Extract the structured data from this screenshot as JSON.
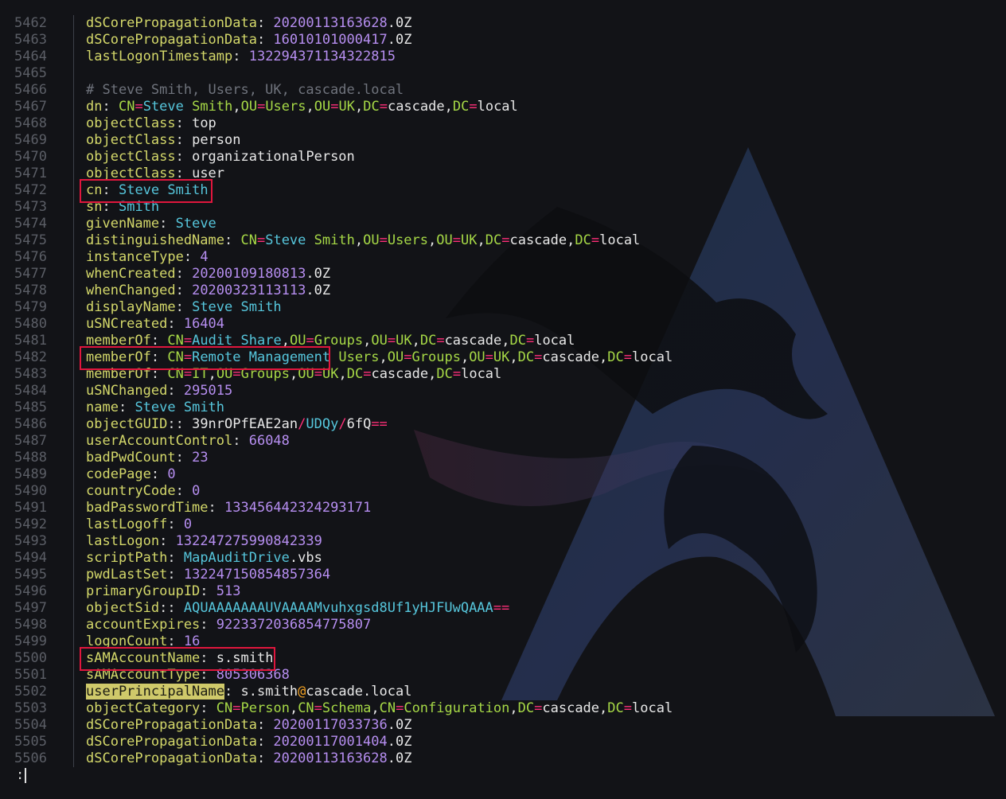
{
  "viewer": {
    "lines": [
      {
        "num": "5462",
        "segs": [
          [
            "k",
            "dSCorePropagationData"
          ],
          [
            "p",
            ": "
          ],
          [
            "n",
            "20200113163628"
          ],
          [
            "v",
            ".0Z"
          ]
        ]
      },
      {
        "num": "5463",
        "segs": [
          [
            "k",
            "dSCorePropagationData"
          ],
          [
            "p",
            ": "
          ],
          [
            "n",
            "16010101000417"
          ],
          [
            "v",
            ".0Z"
          ]
        ]
      },
      {
        "num": "5464",
        "segs": [
          [
            "k",
            "lastLogonTimestamp"
          ],
          [
            "p",
            ": "
          ],
          [
            "n",
            "132294371134322815"
          ]
        ]
      },
      {
        "num": "5465",
        "segs": []
      },
      {
        "num": "5466",
        "segs": [
          [
            "c",
            "# Steve Smith, Users, UK, cascade.local"
          ]
        ]
      },
      {
        "num": "5467",
        "segs": [
          [
            "k",
            "dn"
          ],
          [
            "p",
            ": "
          ],
          [
            "g",
            "CN"
          ],
          [
            "r",
            "="
          ],
          [
            "s",
            "Steve"
          ],
          [
            "v",
            " "
          ],
          [
            "g",
            "Smith"
          ],
          [
            "v",
            ","
          ],
          [
            "g",
            "OU"
          ],
          [
            "r",
            "="
          ],
          [
            "g",
            "Users"
          ],
          [
            "v",
            ","
          ],
          [
            "g",
            "OU"
          ],
          [
            "r",
            "="
          ],
          [
            "g",
            "UK"
          ],
          [
            "v",
            ","
          ],
          [
            "g",
            "DC"
          ],
          [
            "r",
            "="
          ],
          [
            "v",
            "cascade"
          ],
          [
            "v",
            ","
          ],
          [
            "g",
            "DC"
          ],
          [
            "r",
            "="
          ],
          [
            "v",
            "local"
          ]
        ]
      },
      {
        "num": "5468",
        "segs": [
          [
            "k",
            "objectClass"
          ],
          [
            "p",
            ": "
          ],
          [
            "v",
            "top"
          ]
        ]
      },
      {
        "num": "5469",
        "segs": [
          [
            "k",
            "objectClass"
          ],
          [
            "p",
            ": "
          ],
          [
            "v",
            "person"
          ]
        ]
      },
      {
        "num": "5470",
        "segs": [
          [
            "k",
            "objectClass"
          ],
          [
            "p",
            ": "
          ],
          [
            "v",
            "organizationalPerson"
          ]
        ]
      },
      {
        "num": "5471",
        "segs": [
          [
            "k",
            "objectClass"
          ],
          [
            "p",
            ": "
          ],
          [
            "v",
            "user"
          ]
        ]
      },
      {
        "num": "5472",
        "segs": [
          [
            "k",
            "cn"
          ],
          [
            "p",
            ": "
          ],
          [
            "s",
            "Steve Smith"
          ]
        ]
      },
      {
        "num": "5473",
        "segs": [
          [
            "k",
            "sn"
          ],
          [
            "p",
            ": "
          ],
          [
            "s",
            "Smith"
          ]
        ]
      },
      {
        "num": "5474",
        "segs": [
          [
            "k",
            "givenName"
          ],
          [
            "p",
            ": "
          ],
          [
            "s",
            "Steve"
          ]
        ]
      },
      {
        "num": "5475",
        "segs": [
          [
            "k",
            "distinguishedName"
          ],
          [
            "p",
            ": "
          ],
          [
            "g",
            "CN"
          ],
          [
            "r",
            "="
          ],
          [
            "s",
            "Steve"
          ],
          [
            "v",
            " "
          ],
          [
            "g",
            "Smith"
          ],
          [
            "v",
            ","
          ],
          [
            "g",
            "OU"
          ],
          [
            "r",
            "="
          ],
          [
            "g",
            "Users"
          ],
          [
            "v",
            ","
          ],
          [
            "g",
            "OU"
          ],
          [
            "r",
            "="
          ],
          [
            "g",
            "UK"
          ],
          [
            "v",
            ","
          ],
          [
            "g",
            "DC"
          ],
          [
            "r",
            "="
          ],
          [
            "v",
            "cascade"
          ],
          [
            "v",
            ","
          ],
          [
            "g",
            "DC"
          ],
          [
            "r",
            "="
          ],
          [
            "v",
            "local"
          ]
        ]
      },
      {
        "num": "5476",
        "segs": [
          [
            "k",
            "instanceType"
          ],
          [
            "p",
            ": "
          ],
          [
            "n",
            "4"
          ]
        ]
      },
      {
        "num": "5477",
        "segs": [
          [
            "k",
            "whenCreated"
          ],
          [
            "p",
            ": "
          ],
          [
            "n",
            "20200109180813"
          ],
          [
            "v",
            ".0Z"
          ]
        ]
      },
      {
        "num": "5478",
        "segs": [
          [
            "k",
            "whenChanged"
          ],
          [
            "p",
            ": "
          ],
          [
            "n",
            "20200323113113"
          ],
          [
            "v",
            ".0Z"
          ]
        ]
      },
      {
        "num": "5479",
        "segs": [
          [
            "k",
            "displayName"
          ],
          [
            "p",
            ": "
          ],
          [
            "s",
            "Steve Smith"
          ]
        ]
      },
      {
        "num": "5480",
        "segs": [
          [
            "k",
            "uSNCreated"
          ],
          [
            "p",
            ": "
          ],
          [
            "n",
            "16404"
          ]
        ]
      },
      {
        "num": "5481",
        "segs": [
          [
            "k",
            "memberOf"
          ],
          [
            "p",
            ": "
          ],
          [
            "g",
            "CN"
          ],
          [
            "r",
            "="
          ],
          [
            "s",
            "Audit Share"
          ],
          [
            "v",
            ","
          ],
          [
            "g",
            "OU"
          ],
          [
            "r",
            "="
          ],
          [
            "g",
            "Groups"
          ],
          [
            "v",
            ","
          ],
          [
            "g",
            "OU"
          ],
          [
            "r",
            "="
          ],
          [
            "g",
            "UK"
          ],
          [
            "v",
            ","
          ],
          [
            "g",
            "DC"
          ],
          [
            "r",
            "="
          ],
          [
            "v",
            "cascade"
          ],
          [
            "v",
            ","
          ],
          [
            "g",
            "DC"
          ],
          [
            "r",
            "="
          ],
          [
            "v",
            "local"
          ]
        ]
      },
      {
        "num": "5482",
        "segs": [
          [
            "k",
            "memberOf"
          ],
          [
            "p",
            ": "
          ],
          [
            "g",
            "CN"
          ],
          [
            "r",
            "="
          ],
          [
            "s",
            "Remote Management "
          ],
          [
            "g",
            "Users"
          ],
          [
            "v",
            ","
          ],
          [
            "g",
            "OU"
          ],
          [
            "r",
            "="
          ],
          [
            "g",
            "Groups"
          ],
          [
            "v",
            ","
          ],
          [
            "g",
            "OU"
          ],
          [
            "r",
            "="
          ],
          [
            "g",
            "UK"
          ],
          [
            "v",
            ","
          ],
          [
            "g",
            "DC"
          ],
          [
            "r",
            "="
          ],
          [
            "v",
            "cascade"
          ],
          [
            "v",
            ","
          ],
          [
            "g",
            "DC"
          ],
          [
            "r",
            "="
          ],
          [
            "v",
            "local"
          ]
        ]
      },
      {
        "num": "5483",
        "segs": [
          [
            "k",
            "memberOf"
          ],
          [
            "p",
            ": "
          ],
          [
            "g",
            "CN"
          ],
          [
            "r",
            "="
          ],
          [
            "g",
            "IT"
          ],
          [
            "v",
            ","
          ],
          [
            "g",
            "OU"
          ],
          [
            "r",
            "="
          ],
          [
            "g",
            "Groups"
          ],
          [
            "v",
            ","
          ],
          [
            "g",
            "OU"
          ],
          [
            "r",
            "="
          ],
          [
            "g",
            "UK"
          ],
          [
            "v",
            ","
          ],
          [
            "g",
            "DC"
          ],
          [
            "r",
            "="
          ],
          [
            "v",
            "cascade"
          ],
          [
            "v",
            ","
          ],
          [
            "g",
            "DC"
          ],
          [
            "r",
            "="
          ],
          [
            "v",
            "local"
          ]
        ]
      },
      {
        "num": "5484",
        "segs": [
          [
            "k",
            "uSNChanged"
          ],
          [
            "p",
            ": "
          ],
          [
            "n",
            "295015"
          ]
        ]
      },
      {
        "num": "5485",
        "segs": [
          [
            "k",
            "name"
          ],
          [
            "p",
            ": "
          ],
          [
            "s",
            "Steve Smith"
          ]
        ]
      },
      {
        "num": "5486",
        "segs": [
          [
            "k",
            "objectGUID"
          ],
          [
            "p",
            ":: "
          ],
          [
            "v",
            "39nrOPfEAE2an"
          ],
          [
            "r",
            "/"
          ],
          [
            "s",
            "UDQy"
          ],
          [
            "r",
            "/"
          ],
          [
            "v",
            "6fQ"
          ],
          [
            "r",
            "=="
          ]
        ]
      },
      {
        "num": "5487",
        "segs": [
          [
            "k",
            "userAccountControl"
          ],
          [
            "p",
            ": "
          ],
          [
            "n",
            "66048"
          ]
        ]
      },
      {
        "num": "5488",
        "segs": [
          [
            "k",
            "badPwdCount"
          ],
          [
            "p",
            ": "
          ],
          [
            "n",
            "23"
          ]
        ]
      },
      {
        "num": "5489",
        "segs": [
          [
            "k",
            "codePage"
          ],
          [
            "p",
            ": "
          ],
          [
            "n",
            "0"
          ]
        ]
      },
      {
        "num": "5490",
        "segs": [
          [
            "k",
            "countryCode"
          ],
          [
            "p",
            ": "
          ],
          [
            "n",
            "0"
          ]
        ]
      },
      {
        "num": "5491",
        "segs": [
          [
            "k",
            "badPasswordTime"
          ],
          [
            "p",
            ": "
          ],
          [
            "n",
            "133456442324293171"
          ]
        ]
      },
      {
        "num": "5492",
        "segs": [
          [
            "k",
            "lastLogoff"
          ],
          [
            "p",
            ": "
          ],
          [
            "n",
            "0"
          ]
        ]
      },
      {
        "num": "5493",
        "segs": [
          [
            "k",
            "lastLogon"
          ],
          [
            "p",
            ": "
          ],
          [
            "n",
            "132247275990842339"
          ]
        ]
      },
      {
        "num": "5494",
        "segs": [
          [
            "k",
            "scriptPath"
          ],
          [
            "p",
            ": "
          ],
          [
            "s",
            "MapAuditDrive"
          ],
          [
            "v",
            ".vbs"
          ]
        ]
      },
      {
        "num": "5495",
        "segs": [
          [
            "k",
            "pwdLastSet"
          ],
          [
            "p",
            ": "
          ],
          [
            "n",
            "132247150854857364"
          ]
        ]
      },
      {
        "num": "5496",
        "segs": [
          [
            "k",
            "primaryGroupID"
          ],
          [
            "p",
            ": "
          ],
          [
            "n",
            "513"
          ]
        ]
      },
      {
        "num": "5497",
        "segs": [
          [
            "k",
            "objectSid"
          ],
          [
            "p",
            ":: "
          ],
          [
            "s",
            "AQUAAAAAAAUVAAAAMvuhxgsd8Uf1yHJFUwQAAA"
          ],
          [
            "r",
            "=="
          ]
        ]
      },
      {
        "num": "5498",
        "segs": [
          [
            "k",
            "accountExpires"
          ],
          [
            "p",
            ": "
          ],
          [
            "n",
            "9223372036854775807"
          ]
        ]
      },
      {
        "num": "5499",
        "segs": [
          [
            "k",
            "logonCount"
          ],
          [
            "p",
            ": "
          ],
          [
            "n",
            "16"
          ]
        ]
      },
      {
        "num": "5500",
        "segs": [
          [
            "k",
            "sAMAccountName"
          ],
          [
            "p",
            ": "
          ],
          [
            "v",
            "s.smith"
          ]
        ]
      },
      {
        "num": "5501",
        "segs": [
          [
            "k",
            "sAMAccountType"
          ],
          [
            "p",
            ": "
          ],
          [
            "n",
            "805306368"
          ]
        ]
      },
      {
        "num": "5502",
        "segs": [
          [
            "hl",
            "userPrincipalName"
          ],
          [
            "p",
            ": "
          ],
          [
            "v",
            "s.smith"
          ],
          [
            "o",
            "@"
          ],
          [
            "v",
            "cascade.local"
          ]
        ]
      },
      {
        "num": "5503",
        "segs": [
          [
            "k",
            "objectCategory"
          ],
          [
            "p",
            ": "
          ],
          [
            "g",
            "CN"
          ],
          [
            "r",
            "="
          ],
          [
            "g",
            "Person"
          ],
          [
            "v",
            ","
          ],
          [
            "g",
            "CN"
          ],
          [
            "r",
            "="
          ],
          [
            "g",
            "Schema"
          ],
          [
            "v",
            ","
          ],
          [
            "g",
            "CN"
          ],
          [
            "r",
            "="
          ],
          [
            "g",
            "Configuration"
          ],
          [
            "v",
            ","
          ],
          [
            "g",
            "DC"
          ],
          [
            "r",
            "="
          ],
          [
            "v",
            "cascade"
          ],
          [
            "v",
            ","
          ],
          [
            "g",
            "DC"
          ],
          [
            "r",
            "="
          ],
          [
            "v",
            "local"
          ]
        ]
      },
      {
        "num": "5504",
        "segs": [
          [
            "k",
            "dSCorePropagationData"
          ],
          [
            "p",
            ": "
          ],
          [
            "n",
            "20200117033736"
          ],
          [
            "v",
            ".0Z"
          ]
        ]
      },
      {
        "num": "5505",
        "segs": [
          [
            "k",
            "dSCorePropagationData"
          ],
          [
            "p",
            ": "
          ],
          [
            "n",
            "20200117001404"
          ],
          [
            "v",
            ".0Z"
          ]
        ]
      },
      {
        "num": "5506",
        "segs": [
          [
            "k",
            "dSCorePropagationData"
          ],
          [
            "p",
            ": "
          ],
          [
            "n",
            "20200113163628"
          ],
          [
            "v",
            ".0Z"
          ]
        ]
      }
    ]
  },
  "prompt": {
    "text": ":"
  },
  "highlight_color": "#e0163d",
  "background_icon": "arch-dragon-logo"
}
